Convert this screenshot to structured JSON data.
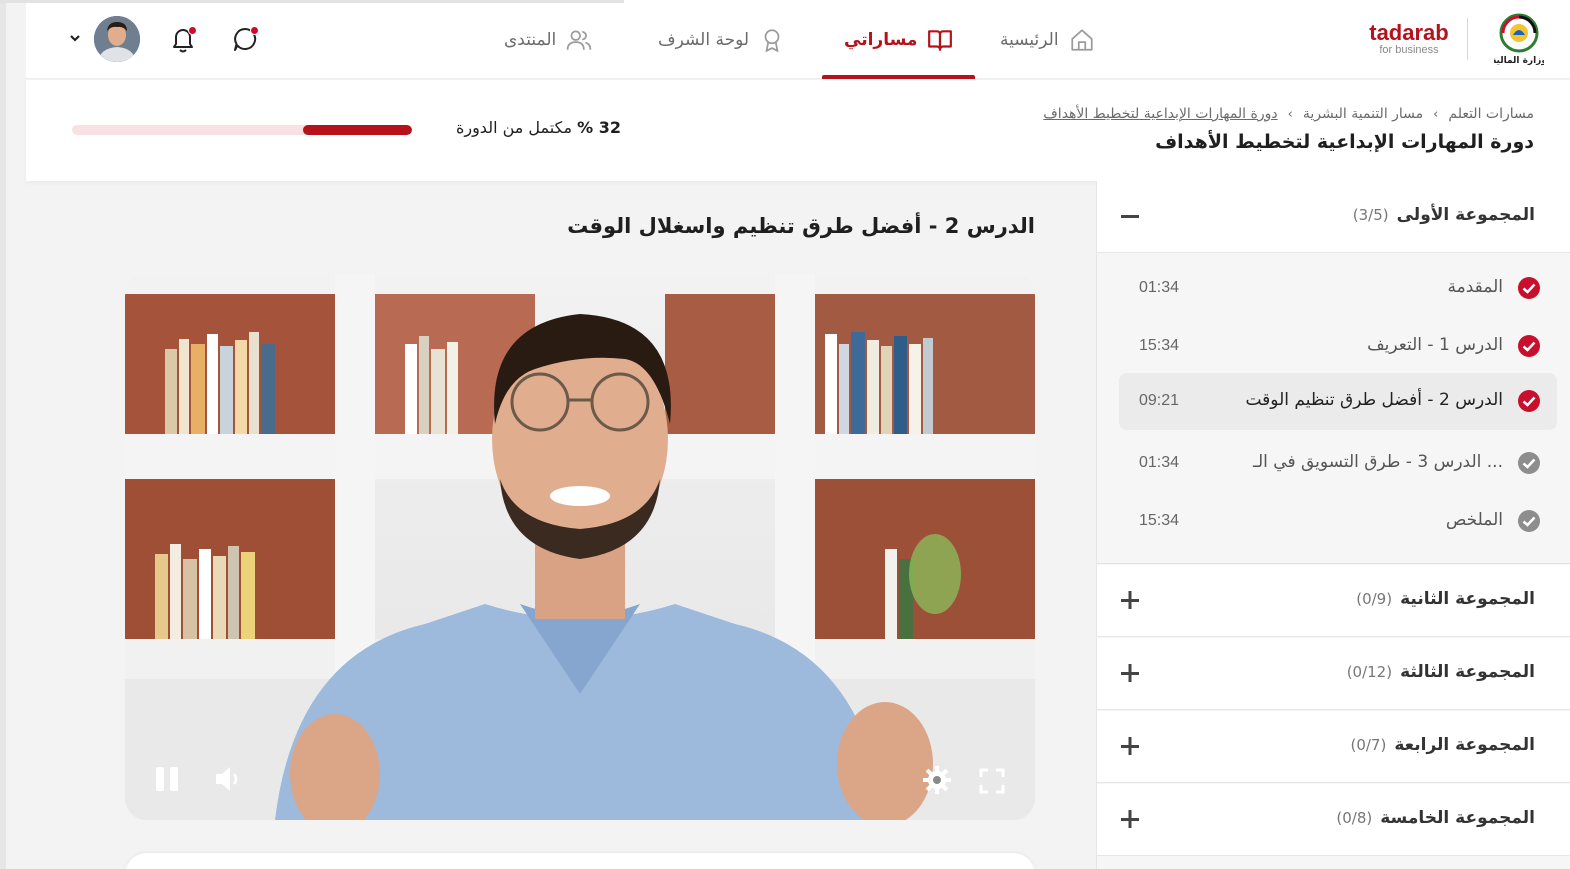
{
  "brand": {
    "logo_text": "tadarab",
    "logo_sub": "for business",
    "ministry_text": "وزارة المالية",
    "accent": "#b5121b"
  },
  "nav": {
    "items": [
      {
        "label": "الرئيسية",
        "icon": "home-icon",
        "active": false
      },
      {
        "label": "مساراتي",
        "icon": "book-icon",
        "active": true
      },
      {
        "label": "لوحة الشرف",
        "icon": "award-icon",
        "active": false
      },
      {
        "label": "المنتدى",
        "icon": "users-icon",
        "active": false
      }
    ]
  },
  "header_icons": [
    "chat-icon",
    "bell-icon",
    "avatar",
    "chevron-down-icon"
  ],
  "breadcrumb": [
    "مسارات التعلم",
    "مسار التنمية البشرية",
    "دورة المهارات الإبداعية لتخطيط الأهداف"
  ],
  "course": {
    "title": "دورة المهارات الإبداعية لتخطيط الأهداف",
    "progress_percent": 32,
    "progress_value": "32 %",
    "progress_text": " مكتمل من الدورة"
  },
  "lesson": {
    "title": "الدرس 2 - أفضل طرق تنظيم واسغلال الوقت"
  },
  "video_controls": [
    "pause-icon",
    "volume-icon",
    "settings-icon",
    "fullscreen-icon"
  ],
  "sidebar": {
    "groups": [
      {
        "name": "المجموعة الأولى",
        "count": "(3/5)",
        "expanded": true,
        "lessons": [
          {
            "title": "المقدمة",
            "time": "01:34",
            "done": true,
            "active": false
          },
          {
            "title": "الدرس 1 - التعريف",
            "time": "15:34",
            "done": true,
            "active": false
          },
          {
            "title": "الدرس 2 - أفضل طرق تنظيم الوقت",
            "time": "09:21",
            "done": true,
            "active": true
          },
          {
            "title": "الدرس 3 - طرق التسويق في الـ ...",
            "time": "01:34",
            "done": false,
            "active": false
          },
          {
            "title": "الملخص",
            "time": "15:34",
            "done": false,
            "active": false
          }
        ]
      },
      {
        "name": "المجموعة الثانية",
        "count": "(0/9)",
        "expanded": false
      },
      {
        "name": "المجموعة الثالثة",
        "count": "(0/12)",
        "expanded": false
      },
      {
        "name": "المجموعة الرابعة",
        "count": "(0/7)",
        "expanded": false
      },
      {
        "name": "المجموعة الخامسة",
        "count": "(0/8)",
        "expanded": false
      }
    ]
  }
}
